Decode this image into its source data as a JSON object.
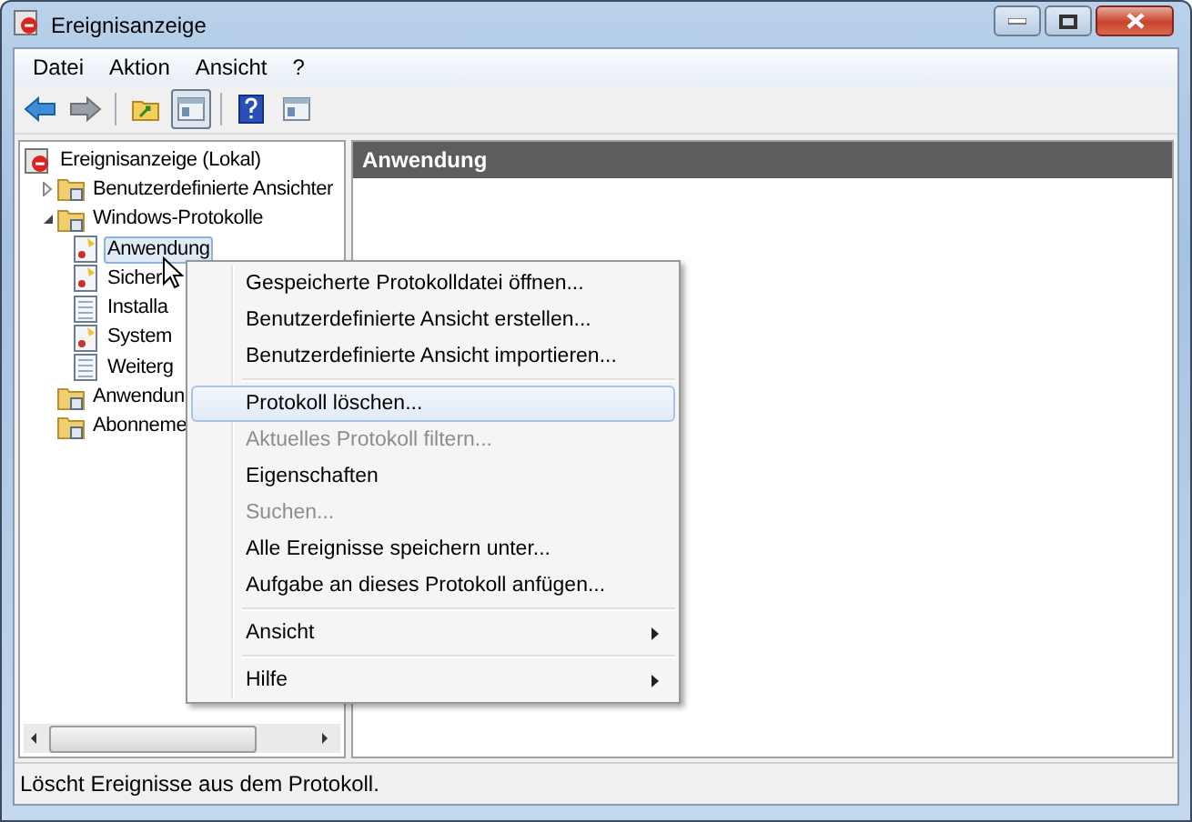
{
  "window": {
    "title": "Ereignisanzeige"
  },
  "menu_bar": [
    "Datei",
    "Aktion",
    "Ansicht",
    "?"
  ],
  "toolbar": [
    {
      "kind": "back",
      "pressed": false
    },
    {
      "kind": "forward",
      "pressed": false
    },
    {
      "kind": "sep"
    },
    {
      "kind": "folder",
      "pressed": false
    },
    {
      "kind": "pane",
      "pressed": true
    },
    {
      "kind": "sep"
    },
    {
      "kind": "help",
      "pressed": false
    },
    {
      "kind": "pane",
      "pressed": false
    }
  ],
  "tree": [
    {
      "label": "Ereignisanzeige (Lokal)",
      "kind": "root",
      "selected": false,
      "children": [
        {
          "label": "Benutzerdefinierte Ansichter",
          "kind": "folder",
          "selected": false,
          "expanded": false
        },
        {
          "label": "Windows-Protokolle",
          "kind": "folder",
          "selected": false,
          "expanded": true,
          "children": [
            {
              "label": "Anwendung",
              "kind": "log",
              "selected": true
            },
            {
              "label": "Sicher",
              "kind": "log",
              "selected": false
            },
            {
              "label": "Installa",
              "kind": "sheet",
              "selected": false
            },
            {
              "label": "System",
              "kind": "log",
              "selected": false
            },
            {
              "label": "Weiterg",
              "kind": "sheet",
              "selected": false
            }
          ]
        },
        {
          "label": "Anwendun",
          "kind": "folder",
          "selected": false
        },
        {
          "label": "Abonneme",
          "kind": "folder",
          "selected": false
        }
      ]
    }
  ],
  "right_pane": {
    "title": "Anwendung"
  },
  "context_menu": [
    {
      "kind": "item",
      "label": "Gespeicherte Protokolldatei öffnen...",
      "disabled": false,
      "selected": false
    },
    {
      "kind": "item",
      "label": "Benutzerdefinierte Ansicht erstellen...",
      "disabled": false,
      "selected": false
    },
    {
      "kind": "item",
      "label": "Benutzerdefinierte Ansicht importieren...",
      "disabled": false,
      "selected": false
    },
    {
      "kind": "separator"
    },
    {
      "kind": "item",
      "label": "Protokoll löschen...",
      "disabled": false,
      "selected": true
    },
    {
      "kind": "item",
      "label": "Aktuelles Protokoll filtern...",
      "disabled": true,
      "selected": false
    },
    {
      "kind": "item",
      "label": "Eigenschaften",
      "disabled": false,
      "selected": false
    },
    {
      "kind": "item",
      "label": "Suchen...",
      "disabled": true,
      "selected": false
    },
    {
      "kind": "item",
      "label": "Alle Ereignisse speichern unter...",
      "disabled": false,
      "selected": false
    },
    {
      "kind": "item",
      "label": "Aufgabe an dieses Protokoll anfügen...",
      "disabled": false,
      "selected": false
    },
    {
      "kind": "separator"
    },
    {
      "kind": "submenu",
      "label": "Ansicht",
      "disabled": false,
      "selected": false
    },
    {
      "kind": "separator"
    },
    {
      "kind": "submenu",
      "label": "Hilfe",
      "disabled": false,
      "selected": false
    }
  ],
  "status_bar": "Löscht Ereignisse aus dem Protokoll."
}
